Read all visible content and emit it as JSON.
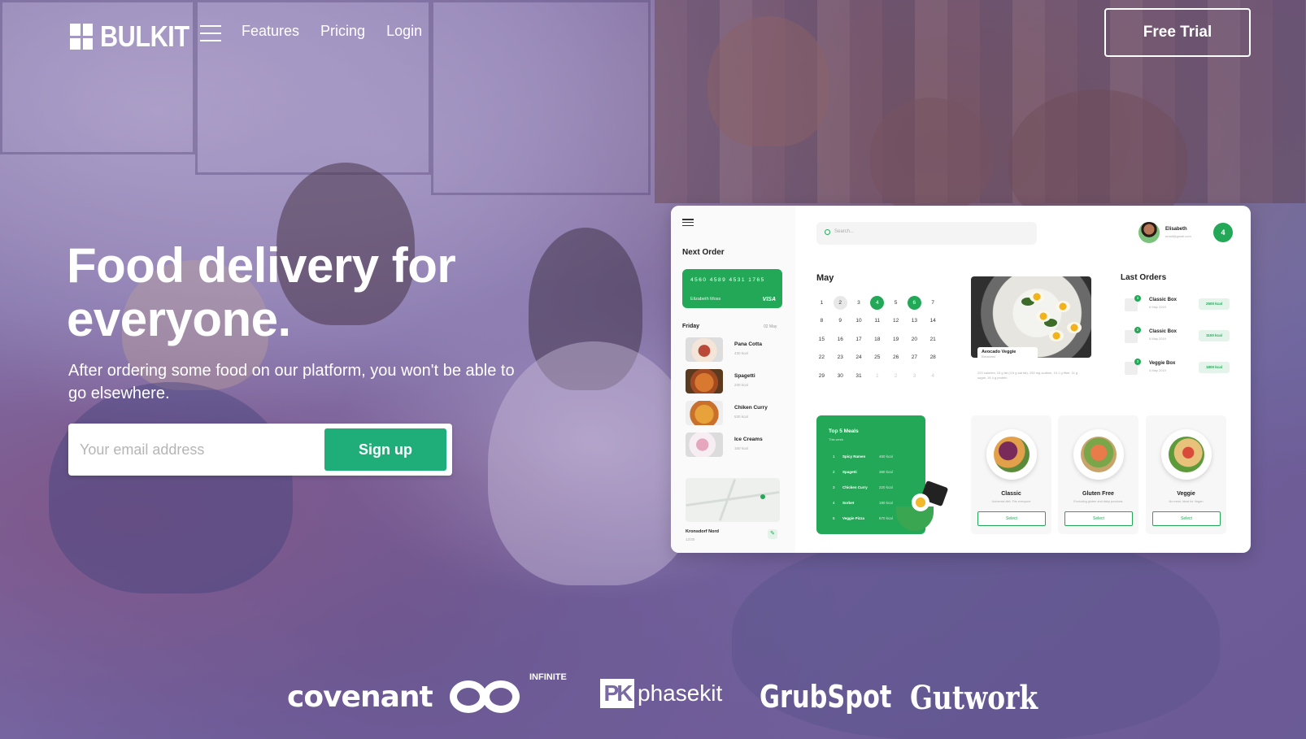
{
  "brand": {
    "name": "BULKIT"
  },
  "nav": {
    "links": [
      "Features",
      "Pricing",
      "Login"
    ],
    "cta_label": "Free Trial"
  },
  "hero": {
    "title_line1": "Food delivery for",
    "title_line2": "everyone.",
    "subtitle": "After ordering some food on our platform, you won't be able to go elsewhere.",
    "email_placeholder": "Your email address",
    "signup_label": "Sign up"
  },
  "dashboard": {
    "next_order_title": "Next Order",
    "card": {
      "number": "4560   4589   4531   1765",
      "holder": "Elizabeth Moss",
      "brand": "VISA"
    },
    "day_label": "Friday",
    "day_date": "02 May",
    "meals": [
      {
        "name": "Pana Cotta",
        "kcal": "430 kcal"
      },
      {
        "name": "Spagetti",
        "kcal": "230 kcal"
      },
      {
        "name": "Chiken Curry",
        "kcal": "530 kcal"
      },
      {
        "name": "Ice Creams",
        "kcal": "150 kcal"
      }
    ],
    "address": "Kronsdorf Nord",
    "address_sub": "12/30",
    "search_placeholder": "Search...",
    "user_name": "Elisabeth",
    "user_email": "email@gmail.com",
    "notif_count": "4",
    "month": "May",
    "calendar": [
      [
        "1",
        "2",
        "3",
        "4",
        "5",
        "6",
        "7"
      ],
      [
        "8",
        "9",
        "10",
        "11",
        "12",
        "13",
        "14"
      ],
      [
        "15",
        "16",
        "17",
        "18",
        "19",
        "20",
        "21"
      ],
      [
        "22",
        "23",
        "24",
        "25",
        "26",
        "27",
        "28"
      ],
      [
        "29",
        "30",
        "31",
        "1",
        "2",
        "3",
        "4"
      ]
    ],
    "featured": {
      "name": "Avocado Veggie",
      "meal": "Breakfast",
      "desc": "220 calories, 15 g fat (4.6 g sat fat), 250 mg sodium, 10.1 g fiber, 11 g sugar, 16.4 g protein"
    },
    "last_orders_title": "Last Orders",
    "last_orders": [
      {
        "badge": "3",
        "name": "Classic Box",
        "date": "6 May 2019",
        "kcal": "2500 kcal"
      },
      {
        "badge": "2",
        "name": "Classic Box",
        "date": "5 May 2019",
        "kcal": "1100 kcal"
      },
      {
        "badge": "3",
        "name": "Veggie Box",
        "date": "4 May 2019",
        "kcal": "1800 kcal"
      }
    ],
    "top5": {
      "title": "Top 5 Meals",
      "subtitle": "This week",
      "items": [
        {
          "n": "1",
          "name": "Spicy Ramen",
          "kcal": "460 kcal"
        },
        {
          "n": "2",
          "name": "Spagetti",
          "kcal": "380 kcal"
        },
        {
          "n": "3",
          "name": "Chicken Curry",
          "kcal": "220 kcal"
        },
        {
          "n": "4",
          "name": "Sorbet",
          "kcal": "190 kcal"
        },
        {
          "n": "5",
          "name": "Veggie Pizza",
          "kcal": "670 kcal"
        }
      ]
    },
    "plans": [
      {
        "name": "Classic",
        "desc": "Universal diet. Fits everyone",
        "btn": "Select"
      },
      {
        "name": "Gluten Free",
        "desc": "Excluding gluten and dairy products",
        "btn": "Select"
      },
      {
        "name": "Veggie",
        "desc": "No meat. Ideal for Vegan",
        "btn": "Select"
      }
    ]
  },
  "partners": {
    "covenant": "covenant",
    "infinite": "INFINITE",
    "phasekit_mark": "PK",
    "phasekit": "phasekit",
    "grubspot": "GrubSpot",
    "gutwork": "Gutwork"
  }
}
